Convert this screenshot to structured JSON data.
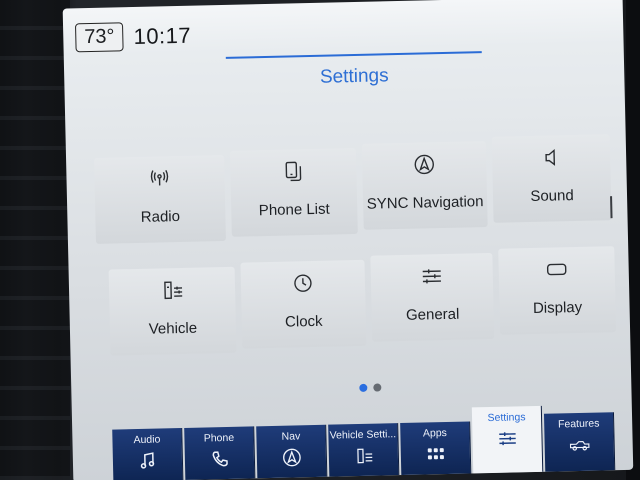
{
  "status": {
    "temperature": "73°",
    "time": "10:17"
  },
  "page": {
    "title": "Settings"
  },
  "tiles": [
    {
      "label": "Radio",
      "icon": "radio-icon"
    },
    {
      "label": "Phone List",
      "icon": "phone-list-icon"
    },
    {
      "label": "SYNC Navigation",
      "icon": "navigation-icon"
    },
    {
      "label": "Sound",
      "icon": "speaker-icon"
    },
    {
      "label": "Vehicle",
      "icon": "vehicle-settings-icon"
    },
    {
      "label": "Clock",
      "icon": "clock-icon"
    },
    {
      "label": "General",
      "icon": "sliders-icon"
    },
    {
      "label": "Display",
      "icon": "display-icon"
    }
  ],
  "pagination": {
    "pages": 2,
    "current": 1
  },
  "nav": [
    {
      "label": "Audio",
      "icon": "music-note-icon"
    },
    {
      "label": "Phone",
      "icon": "phone-icon"
    },
    {
      "label": "Nav",
      "icon": "navigation-icon"
    },
    {
      "label": "Vehicle Setti...",
      "icon": "vehicle-settings-icon"
    },
    {
      "label": "Apps",
      "icon": "apps-grid-icon"
    },
    {
      "label": "Settings",
      "icon": "settings-sliders-icon",
      "active": true
    },
    {
      "label": "Features",
      "icon": "truck-icon"
    }
  ],
  "colors": {
    "accent": "#2b6cd6",
    "nav_bg": "#0e2553"
  }
}
